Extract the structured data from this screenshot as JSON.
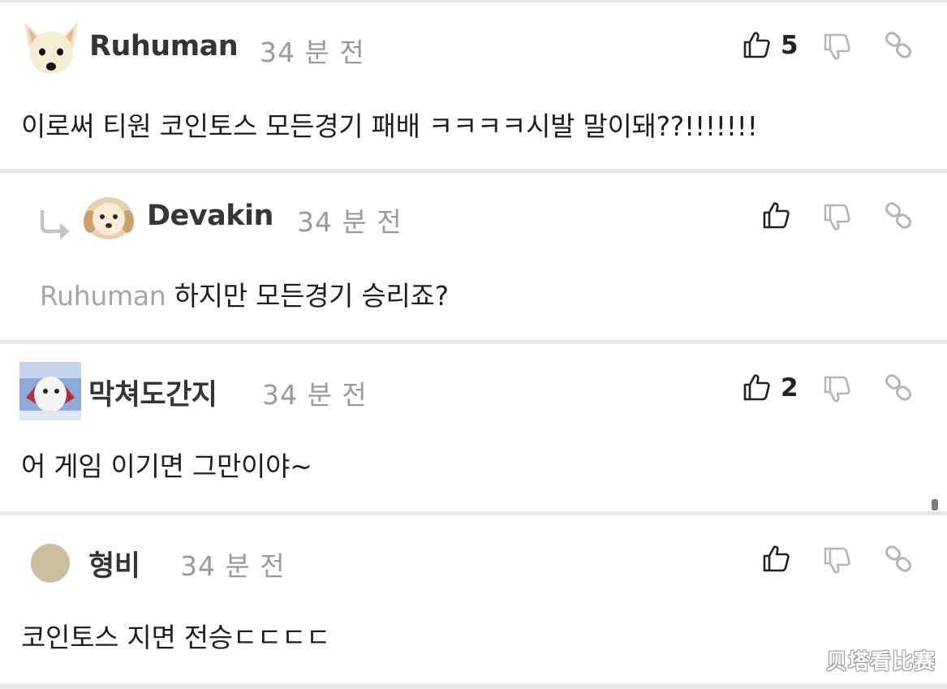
{
  "comments": [
    {
      "username": "Ruhuman",
      "time": "34 분 전",
      "like_count": "5",
      "text": "이로써 티원 코인토스 모든경기 패배  ㅋㅋㅋㅋ시발 말이돼??!!!!!!!",
      "avatar": "chihuahua-avatar"
    },
    {
      "username": "Devakin",
      "time": "34 분 전",
      "like_count": "",
      "mention": "Ruhuman",
      "text": "하지만 모든경기 승리죠?",
      "avatar": "puppy-avatar",
      "is_reply": true
    },
    {
      "username": "막쳐도간지",
      "time": "34 분 전",
      "like_count": "2",
      "text": "어 게임 이기면 그만이야~",
      "avatar": "bird-avatar"
    },
    {
      "username": "형비",
      "time": "34 분 전",
      "like_count": "",
      "text": "코인토스 지면 전승ㄷㄷㄷㄷ",
      "avatar": "default-avatar"
    }
  ],
  "icons": {
    "like": "thumbs-up-icon",
    "dislike": "thumbs-down-icon",
    "share": "link-icon",
    "reply": "reply-arrow-icon"
  },
  "colors": {
    "username": "#353535",
    "time": "#9a9a9a",
    "mention": "#a6a6a6",
    "divider": "#e9e9e9"
  },
  "watermark": "贝塔看比赛"
}
